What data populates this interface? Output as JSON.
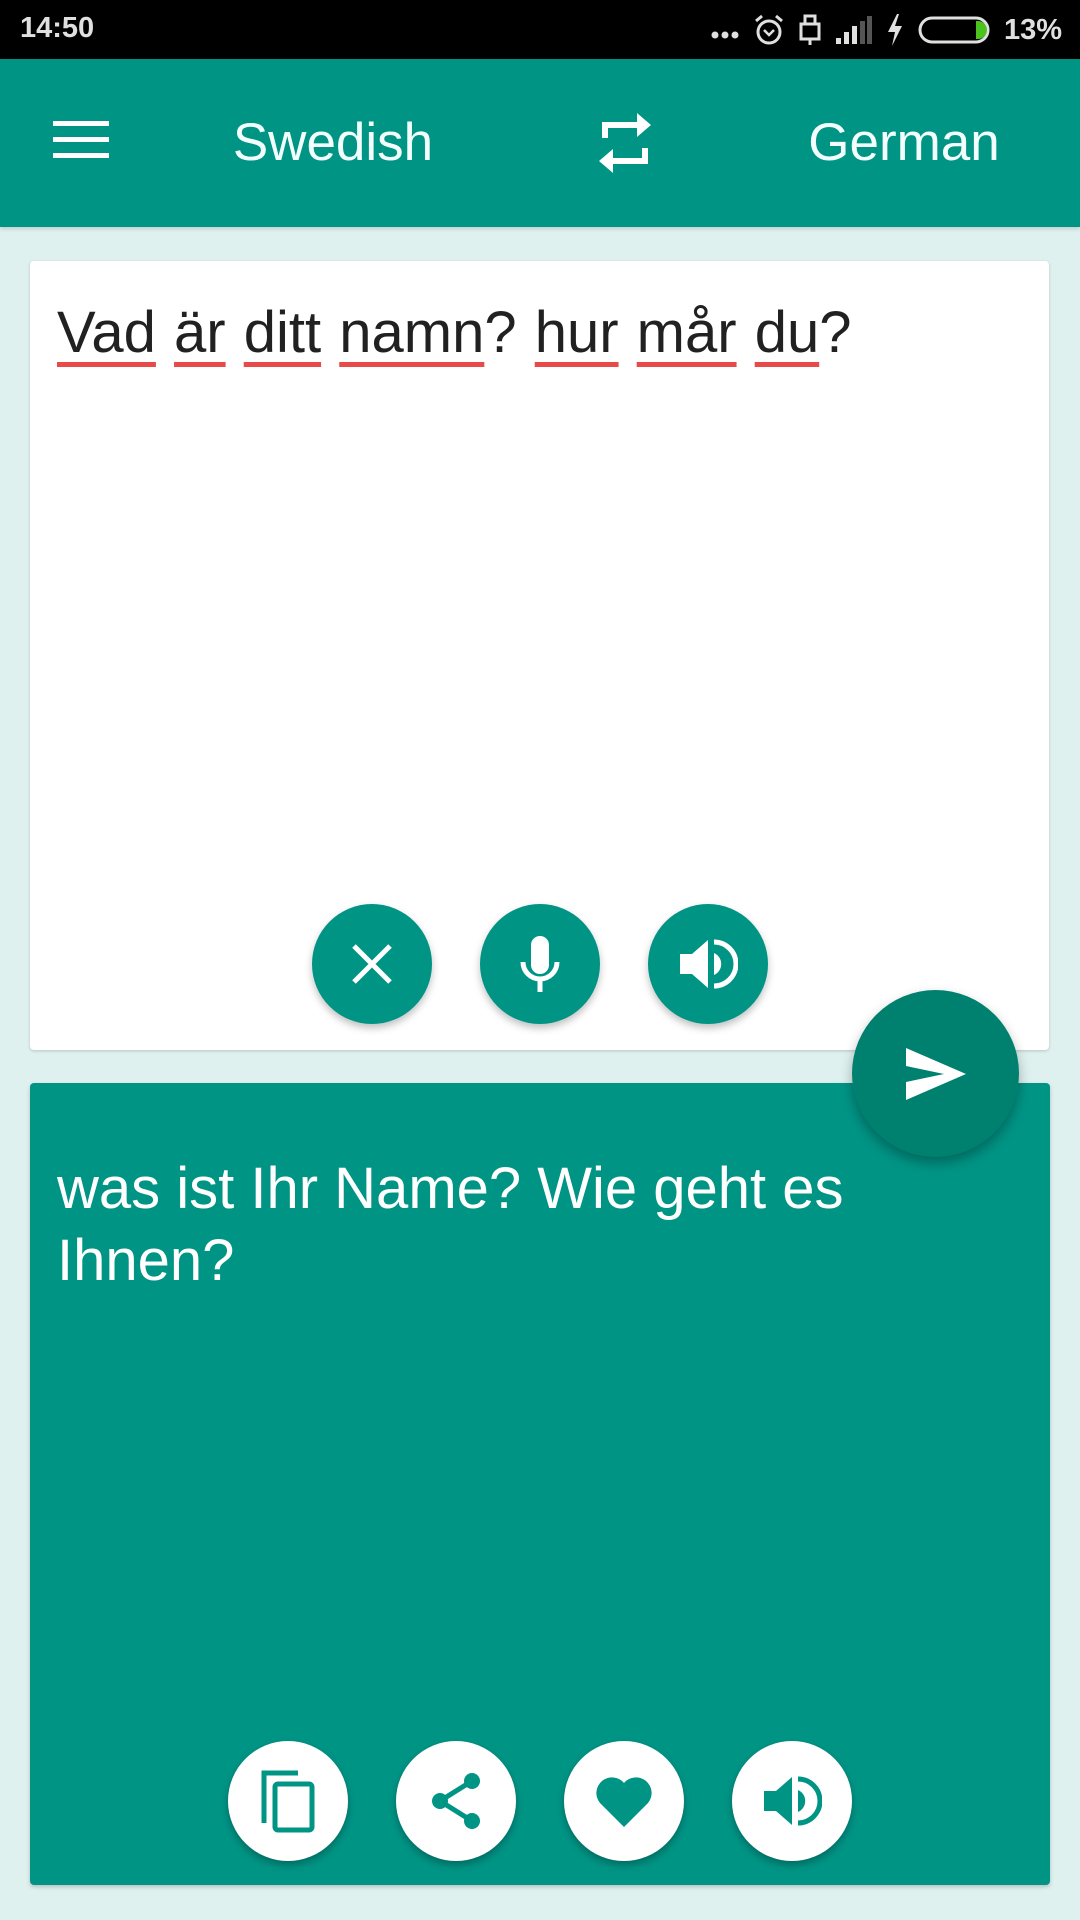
{
  "status_bar": {
    "time": "14:50",
    "icons": [
      "more-notifications-icon",
      "alarm-icon",
      "usb-lock-icon",
      "signal-icon",
      "charging-icon",
      "battery-icon"
    ],
    "battery_percent": "13%",
    "battery_level": 0.13,
    "battery_color": "#4CC21E"
  },
  "app_bar": {
    "menu_icon": "hamburger-menu-icon",
    "source_language": "Swedish",
    "swap_icon": "swap-languages-icon",
    "target_language": "German",
    "color": "#009485"
  },
  "source_card": {
    "words": [
      "Vad",
      "är",
      "ditt",
      "namn",
      "?",
      "hur",
      "mår",
      "du",
      "?"
    ],
    "text": "Vad är ditt namn? hur mår du?",
    "spellcheck_color": "#E84A4A",
    "actions": [
      {
        "name": "clear",
        "icon": "close-icon"
      },
      {
        "name": "voice-input",
        "icon": "microphone-icon"
      },
      {
        "name": "speak-source",
        "icon": "speaker-icon"
      }
    ]
  },
  "translate_button": {
    "icon": "send-icon",
    "color": "#00806F"
  },
  "target_card": {
    "text": "was ist Ihr Name? Wie geht es Ihnen?",
    "actions": [
      {
        "name": "copy",
        "icon": "copy-icon"
      },
      {
        "name": "share",
        "icon": "share-icon"
      },
      {
        "name": "favorite",
        "icon": "heart-icon"
      },
      {
        "name": "speak-translation",
        "icon": "speaker-icon"
      }
    ]
  }
}
